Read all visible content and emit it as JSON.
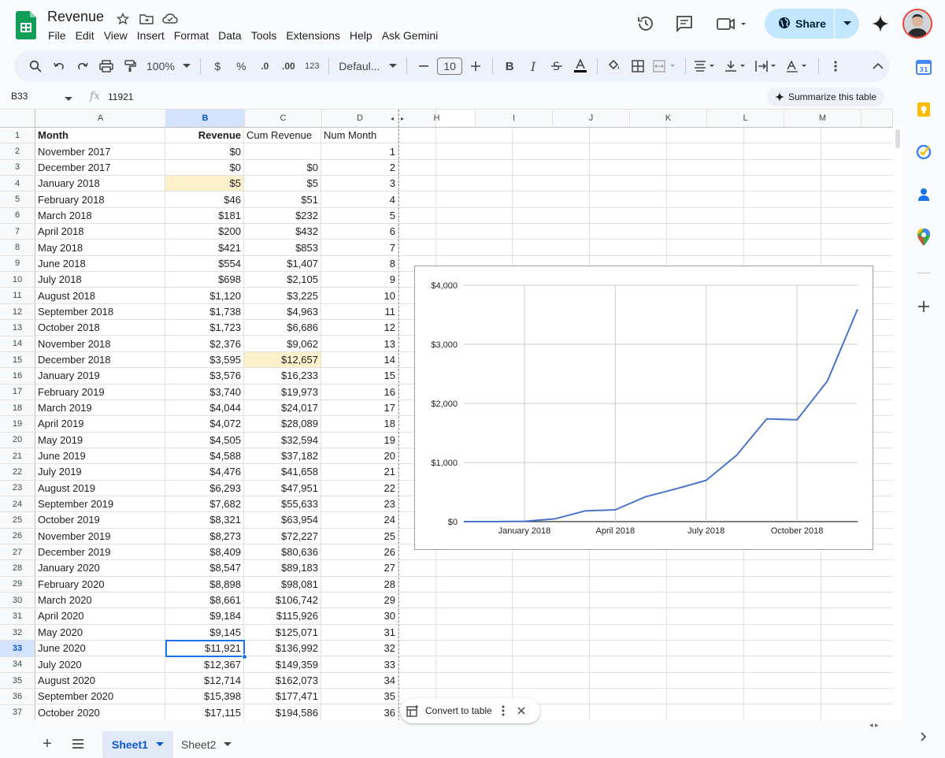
{
  "app": {
    "title": "Revenue",
    "menus": [
      "File",
      "Edit",
      "View",
      "Insert",
      "Format",
      "Data",
      "Tools",
      "Extensions",
      "Help",
      "Ask Gemini"
    ],
    "share_label": "Share"
  },
  "toolbar": {
    "zoom": "100%",
    "currency": "$",
    "percent": "%",
    "dec_decrease": ".0",
    "dec_increase": ".00",
    "number_format": "123",
    "font": "Defaul...",
    "font_size": "10"
  },
  "formula": {
    "cell_ref": "B33",
    "fx": "fx",
    "value": "11921",
    "summarize_label": "Summarize this table"
  },
  "grid": {
    "columns": [
      "A",
      "B",
      "C",
      "D",
      "H",
      "I",
      "J",
      "K",
      "L",
      "M"
    ],
    "header": {
      "A": "Month",
      "B": "Revenue",
      "C": "Cum Revenue",
      "D": "Num Month"
    },
    "rows": [
      {
        "n": "1",
        "A": "Month",
        "B": "Revenue",
        "C": "Cum Revenue",
        "D": "Num Month"
      },
      {
        "n": "2",
        "A": "November 2017",
        "B": "$0",
        "C": "",
        "D": "1"
      },
      {
        "n": "3",
        "A": "December 2017",
        "B": "$0",
        "C": "$0",
        "D": "2"
      },
      {
        "n": "4",
        "A": "January 2018",
        "B": "$5",
        "C": "$5",
        "D": "3"
      },
      {
        "n": "5",
        "A": "February 2018",
        "B": "$46",
        "C": "$51",
        "D": "4"
      },
      {
        "n": "6",
        "A": "March 2018",
        "B": "$181",
        "C": "$232",
        "D": "5"
      },
      {
        "n": "7",
        "A": "April 2018",
        "B": "$200",
        "C": "$432",
        "D": "6"
      },
      {
        "n": "8",
        "A": "May 2018",
        "B": "$421",
        "C": "$853",
        "D": "7"
      },
      {
        "n": "9",
        "A": "June 2018",
        "B": "$554",
        "C": "$1,407",
        "D": "8"
      },
      {
        "n": "10",
        "A": "July 2018",
        "B": "$698",
        "C": "$2,105",
        "D": "9"
      },
      {
        "n": "11",
        "A": "August 2018",
        "B": "$1,120",
        "C": "$3,225",
        "D": "10"
      },
      {
        "n": "12",
        "A": "September 2018",
        "B": "$1,738",
        "C": "$4,963",
        "D": "11"
      },
      {
        "n": "13",
        "A": "October 2018",
        "B": "$1,723",
        "C": "$6,686",
        "D": "12"
      },
      {
        "n": "14",
        "A": "November 2018",
        "B": "$2,376",
        "C": "$9,062",
        "D": "13"
      },
      {
        "n": "15",
        "A": "December 2018",
        "B": "$3,595",
        "C": "$12,657",
        "D": "14"
      },
      {
        "n": "16",
        "A": "January 2019",
        "B": "$3,576",
        "C": "$16,233",
        "D": "15"
      },
      {
        "n": "17",
        "A": "February 2019",
        "B": "$3,740",
        "C": "$19,973",
        "D": "16"
      },
      {
        "n": "18",
        "A": "March 2019",
        "B": "$4,044",
        "C": "$24,017",
        "D": "17"
      },
      {
        "n": "19",
        "A": "April 2019",
        "B": "$4,072",
        "C": "$28,089",
        "D": "18"
      },
      {
        "n": "20",
        "A": "May 2019",
        "B": "$4,505",
        "C": "$32,594",
        "D": "19"
      },
      {
        "n": "21",
        "A": "June 2019",
        "B": "$4,588",
        "C": "$37,182",
        "D": "20"
      },
      {
        "n": "22",
        "A": "July 2019",
        "B": "$4,476",
        "C": "$41,658",
        "D": "21"
      },
      {
        "n": "23",
        "A": "August 2019",
        "B": "$6,293",
        "C": "$47,951",
        "D": "22"
      },
      {
        "n": "24",
        "A": "September 2019",
        "B": "$7,682",
        "C": "$55,633",
        "D": "23"
      },
      {
        "n": "25",
        "A": "October 2019",
        "B": "$8,321",
        "C": "$63,954",
        "D": "24"
      },
      {
        "n": "26",
        "A": "November 2019",
        "B": "$8,273",
        "C": "$72,227",
        "D": "25"
      },
      {
        "n": "27",
        "A": "December 2019",
        "B": "$8,409",
        "C": "$80,636",
        "D": "26"
      },
      {
        "n": "28",
        "A": "January 2020",
        "B": "$8,547",
        "C": "$89,183",
        "D": "27"
      },
      {
        "n": "29",
        "A": "February 2020",
        "B": "$8,898",
        "C": "$98,081",
        "D": "28"
      },
      {
        "n": "30",
        "A": "March 2020",
        "B": "$8,661",
        "C": "$106,742",
        "D": "29"
      },
      {
        "n": "31",
        "A": "April 2020",
        "B": "$9,184",
        "C": "$115,926",
        "D": "30"
      },
      {
        "n": "32",
        "A": "May 2020",
        "B": "$9,145",
        "C": "$125,071",
        "D": "31"
      },
      {
        "n": "33",
        "A": "June 2020",
        "B": "$11,921",
        "C": "$136,992",
        "D": "32"
      },
      {
        "n": "34",
        "A": "July 2020",
        "B": "$12,367",
        "C": "$149,359",
        "D": "33"
      },
      {
        "n": "35",
        "A": "August 2020",
        "B": "$12,714",
        "C": "$162,073",
        "D": "34"
      },
      {
        "n": "36",
        "A": "September 2020",
        "B": "$15,398",
        "C": "$177,471",
        "D": "35"
      },
      {
        "n": "37",
        "A": "October 2020",
        "B": "$17,115",
        "C": "$194,586",
        "D": "36"
      }
    ]
  },
  "chart_data": {
    "type": "line",
    "x": [
      "November 2017",
      "December 2017",
      "January 2018",
      "February 2018",
      "March 2018",
      "April 2018",
      "May 2018",
      "June 2018",
      "July 2018",
      "August 2018",
      "September 2018",
      "October 2018",
      "November 2018",
      "December 2018"
    ],
    "x_tick_labels": [
      "January 2018",
      "April 2018",
      "July 2018",
      "October 2018"
    ],
    "series": [
      {
        "values": [
          0,
          0,
          5,
          46,
          181,
          200,
          421,
          554,
          698,
          1120,
          1738,
          1723,
          2376,
          3595
        ],
        "color": "#4a74c9"
      }
    ],
    "y_tick_labels": [
      "$0",
      "$1,000",
      "$2,000",
      "$3,000",
      "$4,000"
    ],
    "ylim": [
      0,
      4000
    ],
    "grid": true,
    "title": "",
    "xlabel": "",
    "ylabel": ""
  },
  "chip": {
    "label": "Convert to table"
  },
  "sheets": [
    {
      "name": "Sheet1",
      "active": true
    },
    {
      "name": "Sheet2",
      "active": false
    }
  ],
  "colors": {
    "accent": "#0b57d0",
    "share_bg": "#c2e7ff",
    "highlight": "#fdf1cc",
    "line": "#4a74c9"
  }
}
